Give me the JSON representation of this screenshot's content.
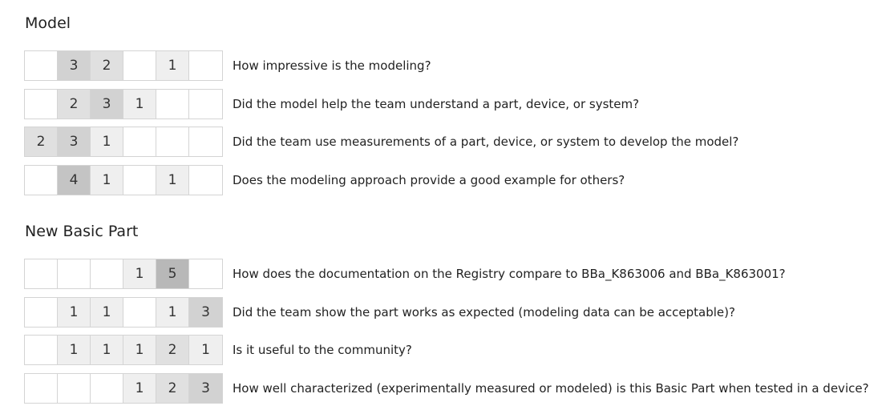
{
  "sections": [
    {
      "title": "Model",
      "rows": [
        {
          "cells": [
            "",
            "3",
            "2",
            "",
            "1",
            ""
          ],
          "question": "How impressive is the modeling?"
        },
        {
          "cells": [
            "",
            "2",
            "3",
            "1",
            "",
            ""
          ],
          "question": "Did the model help the team understand a part, device, or system?"
        },
        {
          "cells": [
            "2",
            "3",
            "1",
            "",
            "",
            ""
          ],
          "question": "Did the team use measurements of a part, device, or system to develop the model?"
        },
        {
          "cells": [
            "",
            "4",
            "1",
            "",
            "1",
            ""
          ],
          "question": "Does the modeling approach provide a good example for others?"
        }
      ]
    },
    {
      "title": "New Basic Part",
      "rows": [
        {
          "cells": [
            "",
            "",
            "",
            "1",
            "5",
            ""
          ],
          "question": "How does the documentation on the Registry compare to BBa_K863006 and BBa_K863001?"
        },
        {
          "cells": [
            "",
            "1",
            "1",
            "",
            "1",
            "3"
          ],
          "question": "Did the team show the part works as expected (modeling data can be acceptable)?"
        },
        {
          "cells": [
            "",
            "1",
            "1",
            "1",
            "2",
            "1"
          ],
          "question": "Is it useful to the community?"
        },
        {
          "cells": [
            "",
            "",
            "",
            "1",
            "2",
            "3"
          ],
          "question": "How well characterized (experimentally measured or modeled) is this Basic Part when tested in a device?"
        }
      ]
    }
  ],
  "shade_colors": [
    "#ffffff",
    "#efefef",
    "#e0e0e0",
    "#d2d2d2",
    "#c4c4c4",
    "#b8b8b8"
  ]
}
